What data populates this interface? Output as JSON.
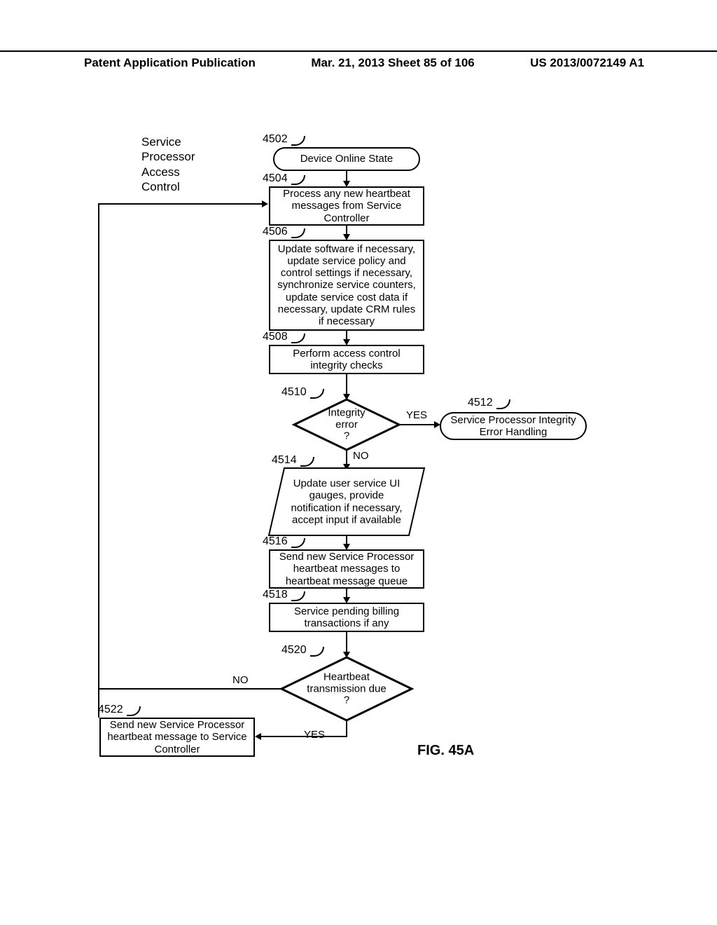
{
  "header": {
    "left": "Patent Application Publication",
    "center": "Mar. 21, 2013  Sheet 85 of 106",
    "right": "US 2013/0072149 A1"
  },
  "title": "Service\nProcessor\nAccess\nControl",
  "figure_label": "FIG. 45A",
  "nums": {
    "n4502": "4502",
    "n4504": "4504",
    "n4506": "4506",
    "n4508": "4508",
    "n4510": "4510",
    "n4512": "4512",
    "n4514": "4514",
    "n4516": "4516",
    "n4518": "4518",
    "n4520": "4520",
    "n4522": "4522"
  },
  "boxes": {
    "b4502": "Device Online State",
    "b4504": "Process any new heartbeat messages from Service Controller",
    "b4506": "Update software if necessary, update service policy and control settings if necessary, synchronize service counters, update service cost data if necessary, update CRM rules if necessary",
    "b4508": "Perform access control integrity checks",
    "b4510": "Integrity\nerror\n?",
    "b4512": "Service Processor Integrity Error Handling",
    "b4514": "Update user service UI gauges, provide notification if necessary, accept input if available",
    "b4516": "Send new Service Processor heartbeat messages to heartbeat message queue",
    "b4518": "Service pending billing transactions if any",
    "b4520": "Heartbeat\ntransmission due\n?",
    "b4522": "Send new Service Processor heartbeat message to Service Controller"
  },
  "labels": {
    "yes": "YES",
    "no": "NO"
  }
}
